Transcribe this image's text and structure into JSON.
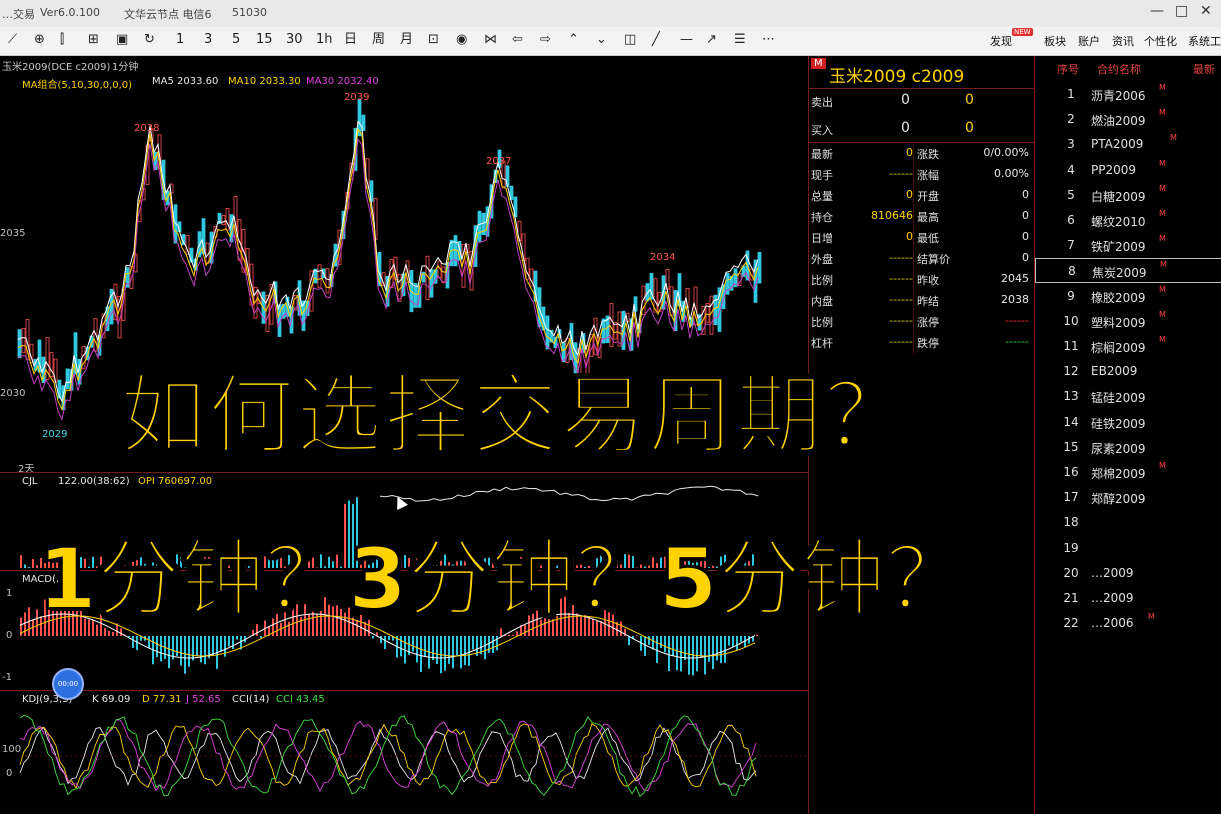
{
  "window": {
    "app_name": "…交易",
    "version": "Ver6.0.100",
    "server": "文华云节点 电信6",
    "port": "51030"
  },
  "toolbar": {
    "periods": [
      "1",
      "3",
      "5",
      "15",
      "30",
      "1h",
      "日",
      "周",
      "月"
    ],
    "right_items": [
      "发现",
      "板块",
      "账户",
      "资讯",
      "个性化",
      "系统工"
    ],
    "badge": "NEW"
  },
  "chart": {
    "contract_label": "玉米2009(DCE c2009)",
    "period_label": "1分钟",
    "ma_legend": {
      "combo": "MA组合(5,10,30,0,0,0)",
      "ma5": "MA5 2033.60",
      "ma10": "MA10 2033.30",
      "ma30": "MA30 2032.40"
    },
    "price_axis": [
      "2035",
      "2030"
    ],
    "price_annotations": [
      "2038",
      "2039",
      "2037",
      "2034",
      "2029"
    ],
    "day_label": "2天",
    "volume_legend": {
      "cjl": "CJL",
      "vol": "122.00(38:62)",
      "opi": "OPI 760697.00"
    },
    "macd_label": "MACD(…",
    "macd_axis": [
      "1",
      "0",
      "-1"
    ],
    "kdj_legend": {
      "kdj": "KDJ(9,3,3)",
      "k": "K 69.09",
      "d": "D 77.31",
      "j": "J 52.65",
      "cci": "CCI(14)",
      "cci_val": "CCI 43.45"
    },
    "kdj_axis": [
      "100",
      "0"
    ],
    "blue_dot_label": "00:00"
  },
  "quote": {
    "name": "玉米2009 c2009",
    "marker": "M",
    "sell_label": "卖出",
    "sell_price": "0",
    "sell_vol": "0",
    "buy_label": "买入",
    "buy_price": "0",
    "buy_vol": "0",
    "left_rows": [
      {
        "label": "最新",
        "value": "0"
      },
      {
        "label": "现手",
        "value": "------"
      },
      {
        "label": "总量",
        "value": "0"
      },
      {
        "label": "持仓",
        "value": "810646"
      },
      {
        "label": "日增",
        "value": "0"
      },
      {
        "label": "外盘",
        "value": "------"
      },
      {
        "label": "比例",
        "value": "------"
      },
      {
        "label": "内盘",
        "value": "------"
      },
      {
        "label": "比例",
        "value": "------"
      },
      {
        "label": "杠杆",
        "value": "------"
      }
    ],
    "right_rows": [
      {
        "label": "涨跌",
        "value": "0/0.00%"
      },
      {
        "label": "涨幅",
        "value": "0.00%"
      },
      {
        "label": "开盘",
        "value": "0"
      },
      {
        "label": "最高",
        "value": "0"
      },
      {
        "label": "最低",
        "value": "0"
      },
      {
        "label": "结算价",
        "value": "0"
      },
      {
        "label": "昨收",
        "value": "2045"
      },
      {
        "label": "昨结",
        "value": "2038"
      },
      {
        "label": "涨停",
        "value": "------"
      },
      {
        "label": "跌停",
        "value": "------"
      }
    ]
  },
  "contract_list": {
    "headers": [
      "序号",
      "合约名称",
      "最新"
    ],
    "items": [
      {
        "num": "1",
        "name": "沥青2006",
        "tag": "M"
      },
      {
        "num": "2",
        "name": "燃油2009",
        "tag": "M"
      },
      {
        "num": "3",
        "name": "PTA2009",
        "tag": "M"
      },
      {
        "num": "4",
        "name": "PP2009",
        "tag": "M"
      },
      {
        "num": "5",
        "name": "白糖2009",
        "tag": "M"
      },
      {
        "num": "6",
        "name": "螺纹2010",
        "tag": "M"
      },
      {
        "num": "7",
        "name": "铁矿2009",
        "tag": "M"
      },
      {
        "num": "8",
        "name": "焦炭2009",
        "tag": "M"
      },
      {
        "num": "9",
        "name": "橡胶2009",
        "tag": "M"
      },
      {
        "num": "10",
        "name": "塑料2009",
        "tag": "M"
      },
      {
        "num": "11",
        "name": "棕榈2009",
        "tag": "M"
      },
      {
        "num": "12",
        "name": "EB2009",
        "tag": ""
      },
      {
        "num": "13",
        "name": "锰硅2009",
        "tag": ""
      },
      {
        "num": "14",
        "name": "硅铁2009",
        "tag": ""
      },
      {
        "num": "15",
        "name": "尿素2009",
        "tag": ""
      },
      {
        "num": "16",
        "name": "郑棉2009",
        "tag": "M"
      },
      {
        "num": "17",
        "name": "郑醇2009",
        "tag": ""
      },
      {
        "num": "18",
        "name": "",
        "tag": ""
      },
      {
        "num": "19",
        "name": "",
        "tag": ""
      },
      {
        "num": "20",
        "name": "…2009",
        "tag": ""
      },
      {
        "num": "21",
        "name": "…2009",
        "tag": ""
      },
      {
        "num": "22",
        "name": "…2006",
        "tag": "M"
      }
    ]
  },
  "overlay": {
    "line1": "如何选择交易周期？",
    "line2": "1分钟？3分钟？5分钟？"
  }
}
